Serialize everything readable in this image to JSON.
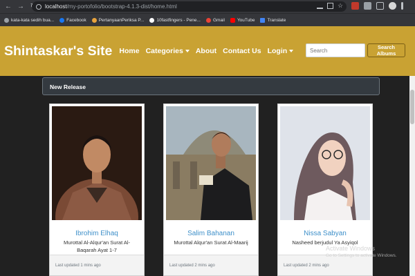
{
  "browser": {
    "url_host": "localhost",
    "url_path": "/my-portofolio/bootstrap-4.1.3-dist/home.html",
    "bookmarks": [
      {
        "label": "kata-kata sedih bua...",
        "icon": "bookmark-icon"
      },
      {
        "label": "Facebook",
        "icon": "facebook-icon"
      },
      {
        "label": "PertanyaanPeriksa P...",
        "icon": "doc-icon"
      },
      {
        "label": "10fastfingers - Pene...",
        "icon": "keyboard-icon"
      },
      {
        "label": "Gmail",
        "icon": "gmail-icon"
      },
      {
        "label": "YouTube",
        "icon": "youtube-icon"
      },
      {
        "label": "Translate",
        "icon": "translate-icon"
      }
    ]
  },
  "navbar": {
    "brand": "Shintaskar's Site",
    "links": [
      {
        "label": "Home",
        "dropdown": false
      },
      {
        "label": "Categories",
        "dropdown": true
      },
      {
        "label": "About",
        "dropdown": false
      },
      {
        "label": "Contact Us",
        "dropdown": false
      },
      {
        "label": "Login",
        "dropdown": true
      }
    ],
    "search_placeholder": "Search",
    "search_button": "Search Albums"
  },
  "section": {
    "title": "New Release"
  },
  "cards": [
    {
      "name": "Ibrohim Elhaq",
      "desc": "Murottal Al-Alqur'an Surat Al-Baqarah Ayat 1-7",
      "updated": "Last updated 1 mins ago"
    },
    {
      "name": "Salim Bahanan",
      "desc": "Murottal Alqur'an Surat Al-Maarij",
      "updated": "Last updated 2 mins ago"
    },
    {
      "name": "Nissa Sabyan",
      "desc": "Nasheed berjudul Ya Asyiqol",
      "updated": "Last updated 2 mins ago"
    }
  ],
  "watermark": {
    "line1": "Activate Windows",
    "line2": "Go to Settings to activate Windows."
  },
  "colors": {
    "navbar": "#c9a233",
    "page_bg": "#212121",
    "link": "#3d8fc9"
  }
}
